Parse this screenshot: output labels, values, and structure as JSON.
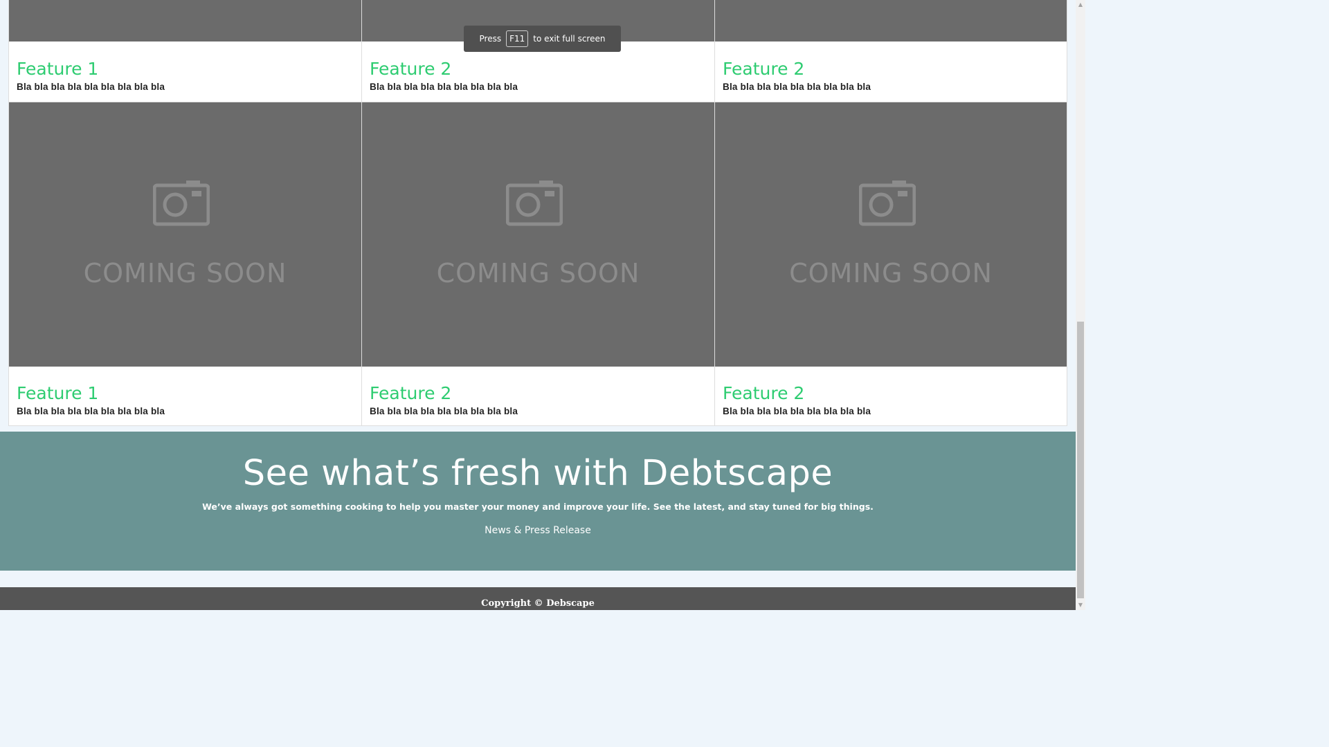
{
  "fullscreen_toast": {
    "press": "Press",
    "key": "F11",
    "suffix": "to exit full screen"
  },
  "features_row1": [
    {
      "title": "Feature 1",
      "text": "Bla bla bla bla bla bla bla bla bla"
    },
    {
      "title": "Feature 2",
      "text": "Bla bla bla bla bla bla bla bla bla"
    },
    {
      "title": "Feature 2",
      "text": "Bla bla bla bla bla bla bla bla bla"
    }
  ],
  "features_row2": [
    {
      "title": "Feature 1",
      "text": "Bla bla bla bla bla bla bla bla bla",
      "placeholder": "COMING SOON"
    },
    {
      "title": "Feature 2",
      "text": "Bla bla bla bla bla bla bla bla bla",
      "placeholder": "COMING SOON"
    },
    {
      "title": "Feature 2",
      "text": "Bla bla bla bla bla bla bla bla bla",
      "placeholder": "COMING SOON"
    }
  ],
  "promo": {
    "title": "See what’s fresh with Debtscape",
    "subtitle": "We’ve always got something cooking to help you master your money and improve your life. See the latest, and stay tuned for big things.",
    "link": "News & Press Release"
  },
  "footer": {
    "copyright": "Copyright © Debscape"
  },
  "colors": {
    "feature_title": "#2ecc71",
    "image_placeholder": "#6b6b6b",
    "promo_bg": "#6a9494",
    "footer_bg": "#555555"
  },
  "icons": {
    "placeholder": "camera-icon",
    "scroll_up": "arrow-up-icon",
    "scroll_down": "arrow-down-icon"
  }
}
